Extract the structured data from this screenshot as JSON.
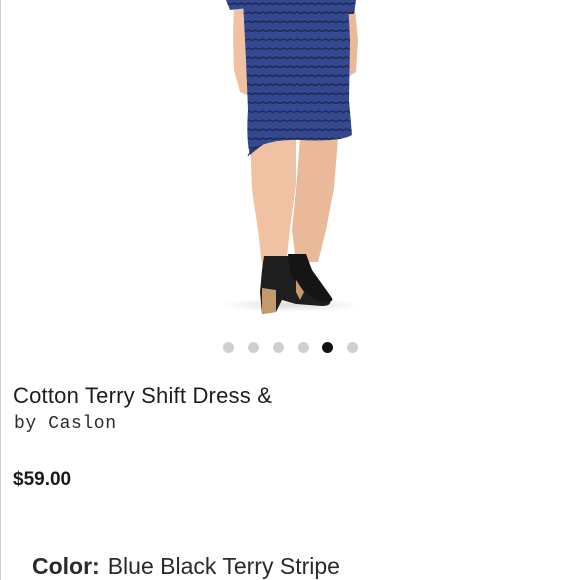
{
  "product": {
    "title": "Cotton Terry Shift Dress &",
    "brand": "by Caslon",
    "price": "$59.00",
    "color_label": "Color:",
    "color_value": "Blue  Black Terry Stripe"
  },
  "carousel": {
    "total_images": 6,
    "active_index": 4
  },
  "colors": {
    "active_dot": "#111111",
    "inactive_dot": "#cfcfcf",
    "dress_blue": "#2f4690"
  }
}
